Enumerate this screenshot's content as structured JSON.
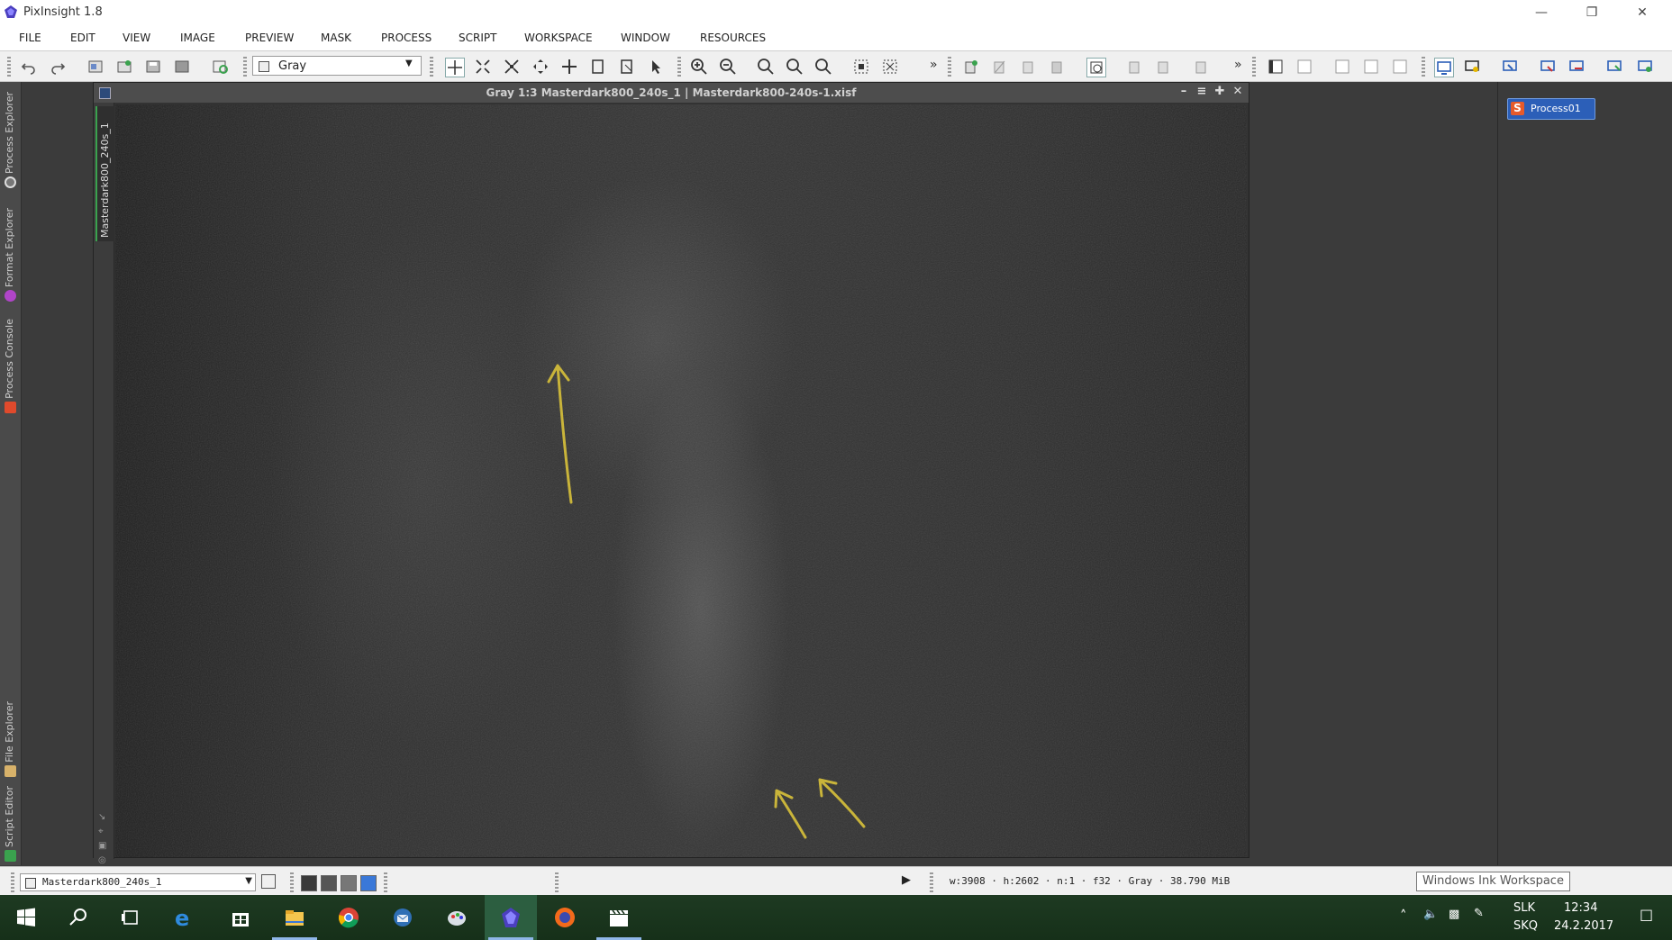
{
  "app": {
    "title": "PixInsight 1.8"
  },
  "menu": [
    "FILE",
    "EDIT",
    "VIEW",
    "IMAGE",
    "PREVIEW",
    "MASK",
    "PROCESS",
    "SCRIPT",
    "WORKSPACE",
    "WINDOW",
    "RESOURCES"
  ],
  "toolbar": {
    "colorspace_value": "Gray",
    "overflow_glyph": "»"
  },
  "left_dock_tabs": [
    "Process Explorer",
    "Format Explorer",
    "Process Console",
    "File Explorer",
    "Script Editor"
  ],
  "image_window": {
    "title": "Gray 1:3 Masterdark800_240s_1 | Masterdark800-240s-1.xisf",
    "view_tab": "Masterdark800_240s_1"
  },
  "right_dock": {
    "process_icon_label": "Process01",
    "process_icon_glyph": "S"
  },
  "statusbar": {
    "view_select_value": "Masterdark800_240s_1",
    "info": "w:3908 · h:2602 · n:1 · f32 · Gray · 38.790 MiB",
    "play_glyph": "▶"
  },
  "tooltip": "Windows Ink Workspace",
  "taskbar": {
    "apps": [
      "start-icon",
      "search-icon",
      "task-view-icon",
      "edge-icon",
      "store-icon",
      "file-explorer-icon",
      "chrome-icon",
      "thunderbird-icon",
      "paint-icon",
      "pixinsight-icon",
      "firefox-icon",
      "clapperboard-icon"
    ],
    "lang_top": "SLK",
    "lang_bottom": "SKQ",
    "time": "12:34",
    "date": "24.2.2017"
  },
  "colors": {
    "annotation_arrow": "#c9b43a",
    "accent_blue": "#2c5fb8",
    "taskbar": "#1b351e"
  }
}
